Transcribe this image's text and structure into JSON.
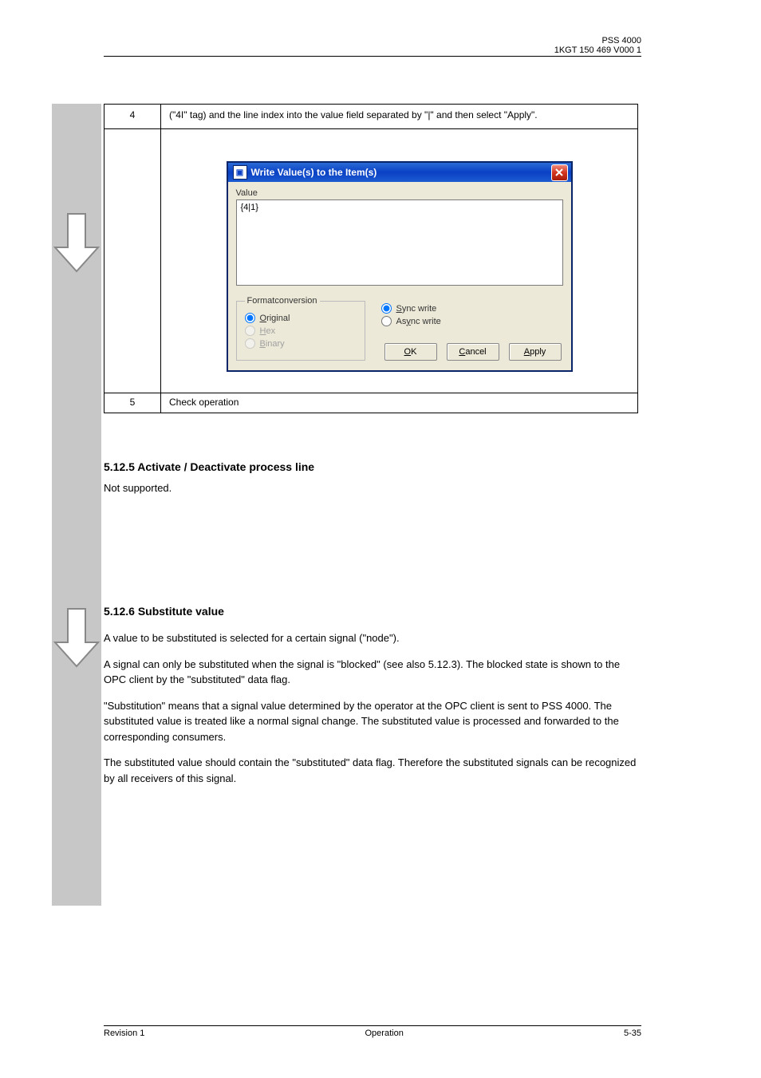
{
  "header": {
    "product": "PSS 4000",
    "docno": "1KGT 150 469 V000 1"
  },
  "table": {
    "step4": "4",
    "step4_text": "(\"4I\" tag) and the line index into the value field separated by \"|\" and then select \"Apply\".",
    "step5": "5",
    "step5_text": "Check operation"
  },
  "dialog": {
    "title": "Write Value(s) to the Item(s)",
    "value_label": "Value",
    "value": "{4|1}",
    "format_legend": "Formatconversion",
    "original": "Original",
    "hex": "Hex",
    "binary": "Binary",
    "sync": "Sync write",
    "async": "Async write",
    "ok": "OK",
    "cancel": "Cancel",
    "apply": "Apply"
  },
  "section1": {
    "title": "5.12.5 Activate / Deactivate process line",
    "body": "Not supported."
  },
  "section2": {
    "title": "5.12.6 Substitute value",
    "p1": "A value to be substituted is selected for a certain signal (\"node\").",
    "p2": "A signal can only be substituted when the signal is \"blocked\" (see also 5.12.3). The blocked state is shown to the OPC client by the \"substituted\" data flag.",
    "p3": "\"Substitution\" means that a signal value determined by the operator at the OPC client is sent to PSS 4000. The substituted value is treated like a normal signal change. The substituted value is processed and forwarded to the corresponding consumers.",
    "p4": "The substituted value should contain the \"substituted\" data flag. Therefore the substituted signals can be recognized by all receivers of this signal."
  },
  "footer": {
    "rev": "Revision 1",
    "chapter": "Operation",
    "page": "5-35"
  }
}
